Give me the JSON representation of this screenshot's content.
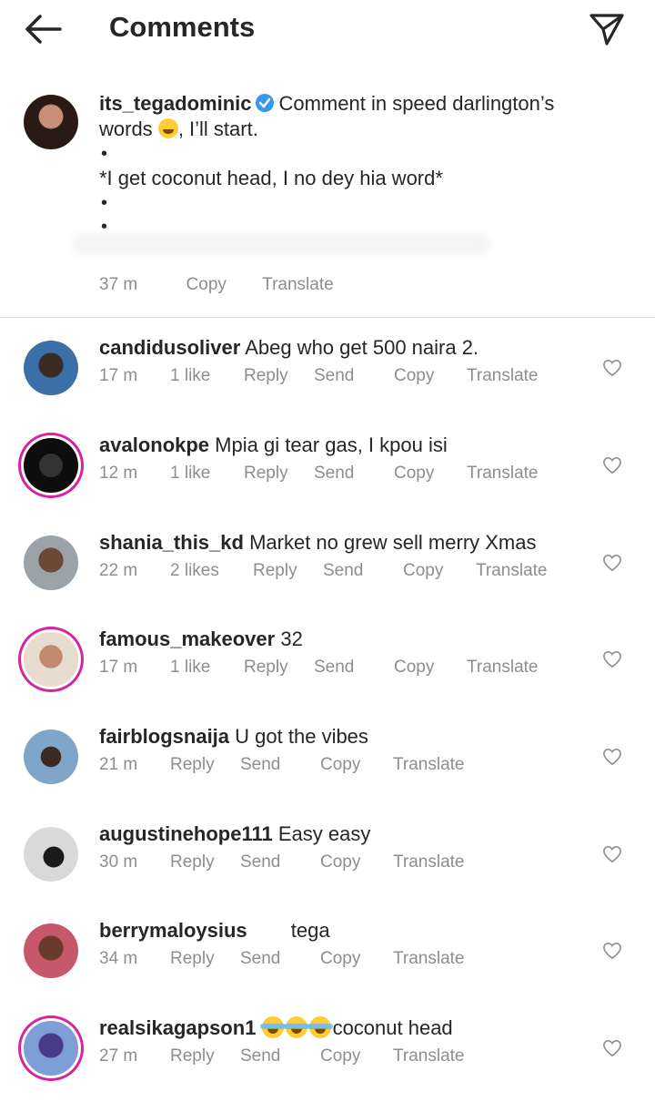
{
  "header": {
    "title": "Comments",
    "back_icon": "arrow-left-icon",
    "share_icon": "paper-plane-icon"
  },
  "caption": {
    "username": "its_tegadominic",
    "verified": true,
    "text_part1": "Comment in speed darlington’s",
    "text_part2": "words",
    "text_part3": ", I’ll start.",
    "bullet1": "•",
    "line2": "*I get coconut head, I no dey hia word*",
    "bullet2": "•",
    "bullet3": "•",
    "time": "37 m",
    "copy": "Copy",
    "translate": "Translate"
  },
  "comments": [
    {
      "username": "candidusoliver",
      "text": "Abeg who get 500 naira 2.",
      "time": "17 m",
      "likes": "1 like",
      "reply": "Reply",
      "send": "Send",
      "copy": "Copy",
      "translate": "Translate"
    },
    {
      "username": "avalonokpe",
      "text": "Mpia gi tear gas, I kpou isi",
      "time": "12 m",
      "likes": "1 like",
      "reply": "Reply",
      "send": "Send",
      "copy": "Copy",
      "translate": "Translate"
    },
    {
      "username": "shania_this_kd",
      "text": "Market no grew sell merry Xmas",
      "time": "22 m",
      "likes": "2 likes",
      "reply": "Reply",
      "send": "Send",
      "copy": "Copy",
      "translate": "Translate"
    },
    {
      "username": "famous_makeover",
      "text": "32",
      "time": "17 m",
      "likes": "1 like",
      "reply": "Reply",
      "send": "Send",
      "copy": "Copy",
      "translate": "Translate"
    },
    {
      "username": "fairblogsnaija",
      "text": "U got the vibes",
      "time": "21 m",
      "reply": "Reply",
      "send": "Send",
      "copy": "Copy",
      "translate": "Translate"
    },
    {
      "username": "augustinehope111",
      "text": "Easy easy",
      "time": "30 m",
      "reply": "Reply",
      "send": "Send",
      "copy": "Copy",
      "translate": "Translate"
    },
    {
      "username": "berrymaloysius",
      "text": "tega",
      "time": "34 m",
      "reply": "Reply",
      "send": "Send",
      "copy": "Copy",
      "translate": "Translate"
    },
    {
      "username": "realsikagapson1",
      "text": "coconut head",
      "time": "27 m",
      "reply": "Reply",
      "send": "Send",
      "copy": "Copy",
      "translate": "Translate"
    }
  ],
  "colors": {
    "text": "#262626",
    "meta": "#8e8e8e",
    "verified": "#3897f0",
    "story_ring": "#d6249f",
    "divider": "#dbdbdb"
  }
}
